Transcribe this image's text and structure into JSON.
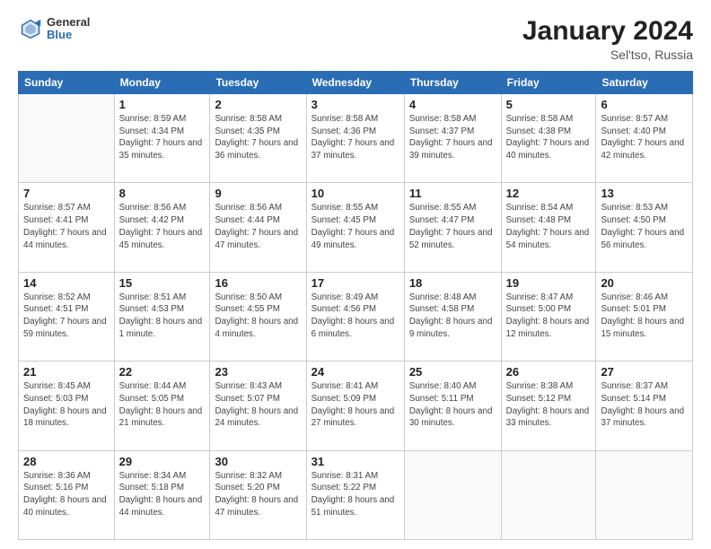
{
  "header": {
    "logo": {
      "general": "General",
      "blue": "Blue"
    },
    "title": "January 2024",
    "subtitle": "Sel'tso, Russia"
  },
  "calendar": {
    "days_of_week": [
      "Sunday",
      "Monday",
      "Tuesday",
      "Wednesday",
      "Thursday",
      "Friday",
      "Saturday"
    ],
    "weeks": [
      [
        {
          "day": "",
          "sunrise": "",
          "sunset": "",
          "daylight": "",
          "empty": true
        },
        {
          "day": "1",
          "sunrise": "Sunrise: 8:59 AM",
          "sunset": "Sunset: 4:34 PM",
          "daylight": "Daylight: 7 hours and 35 minutes."
        },
        {
          "day": "2",
          "sunrise": "Sunrise: 8:58 AM",
          "sunset": "Sunset: 4:35 PM",
          "daylight": "Daylight: 7 hours and 36 minutes."
        },
        {
          "day": "3",
          "sunrise": "Sunrise: 8:58 AM",
          "sunset": "Sunset: 4:36 PM",
          "daylight": "Daylight: 7 hours and 37 minutes."
        },
        {
          "day": "4",
          "sunrise": "Sunrise: 8:58 AM",
          "sunset": "Sunset: 4:37 PM",
          "daylight": "Daylight: 7 hours and 39 minutes."
        },
        {
          "day": "5",
          "sunrise": "Sunrise: 8:58 AM",
          "sunset": "Sunset: 4:38 PM",
          "daylight": "Daylight: 7 hours and 40 minutes."
        },
        {
          "day": "6",
          "sunrise": "Sunrise: 8:57 AM",
          "sunset": "Sunset: 4:40 PM",
          "daylight": "Daylight: 7 hours and 42 minutes."
        }
      ],
      [
        {
          "day": "7",
          "sunrise": "Sunrise: 8:57 AM",
          "sunset": "Sunset: 4:41 PM",
          "daylight": "Daylight: 7 hours and 44 minutes."
        },
        {
          "day": "8",
          "sunrise": "Sunrise: 8:56 AM",
          "sunset": "Sunset: 4:42 PM",
          "daylight": "Daylight: 7 hours and 45 minutes."
        },
        {
          "day": "9",
          "sunrise": "Sunrise: 8:56 AM",
          "sunset": "Sunset: 4:44 PM",
          "daylight": "Daylight: 7 hours and 47 minutes."
        },
        {
          "day": "10",
          "sunrise": "Sunrise: 8:55 AM",
          "sunset": "Sunset: 4:45 PM",
          "daylight": "Daylight: 7 hours and 49 minutes."
        },
        {
          "day": "11",
          "sunrise": "Sunrise: 8:55 AM",
          "sunset": "Sunset: 4:47 PM",
          "daylight": "Daylight: 7 hours and 52 minutes."
        },
        {
          "day": "12",
          "sunrise": "Sunrise: 8:54 AM",
          "sunset": "Sunset: 4:48 PM",
          "daylight": "Daylight: 7 hours and 54 minutes."
        },
        {
          "day": "13",
          "sunrise": "Sunrise: 8:53 AM",
          "sunset": "Sunset: 4:50 PM",
          "daylight": "Daylight: 7 hours and 56 minutes."
        }
      ],
      [
        {
          "day": "14",
          "sunrise": "Sunrise: 8:52 AM",
          "sunset": "Sunset: 4:51 PM",
          "daylight": "Daylight: 7 hours and 59 minutes."
        },
        {
          "day": "15",
          "sunrise": "Sunrise: 8:51 AM",
          "sunset": "Sunset: 4:53 PM",
          "daylight": "Daylight: 8 hours and 1 minute."
        },
        {
          "day": "16",
          "sunrise": "Sunrise: 8:50 AM",
          "sunset": "Sunset: 4:55 PM",
          "daylight": "Daylight: 8 hours and 4 minutes."
        },
        {
          "day": "17",
          "sunrise": "Sunrise: 8:49 AM",
          "sunset": "Sunset: 4:56 PM",
          "daylight": "Daylight: 8 hours and 6 minutes."
        },
        {
          "day": "18",
          "sunrise": "Sunrise: 8:48 AM",
          "sunset": "Sunset: 4:58 PM",
          "daylight": "Daylight: 8 hours and 9 minutes."
        },
        {
          "day": "19",
          "sunrise": "Sunrise: 8:47 AM",
          "sunset": "Sunset: 5:00 PM",
          "daylight": "Daylight: 8 hours and 12 minutes."
        },
        {
          "day": "20",
          "sunrise": "Sunrise: 8:46 AM",
          "sunset": "Sunset: 5:01 PM",
          "daylight": "Daylight: 8 hours and 15 minutes."
        }
      ],
      [
        {
          "day": "21",
          "sunrise": "Sunrise: 8:45 AM",
          "sunset": "Sunset: 5:03 PM",
          "daylight": "Daylight: 8 hours and 18 minutes."
        },
        {
          "day": "22",
          "sunrise": "Sunrise: 8:44 AM",
          "sunset": "Sunset: 5:05 PM",
          "daylight": "Daylight: 8 hours and 21 minutes."
        },
        {
          "day": "23",
          "sunrise": "Sunrise: 8:43 AM",
          "sunset": "Sunset: 5:07 PM",
          "daylight": "Daylight: 8 hours and 24 minutes."
        },
        {
          "day": "24",
          "sunrise": "Sunrise: 8:41 AM",
          "sunset": "Sunset: 5:09 PM",
          "daylight": "Daylight: 8 hours and 27 minutes."
        },
        {
          "day": "25",
          "sunrise": "Sunrise: 8:40 AM",
          "sunset": "Sunset: 5:11 PM",
          "daylight": "Daylight: 8 hours and 30 minutes."
        },
        {
          "day": "26",
          "sunrise": "Sunrise: 8:38 AM",
          "sunset": "Sunset: 5:12 PM",
          "daylight": "Daylight: 8 hours and 33 minutes."
        },
        {
          "day": "27",
          "sunrise": "Sunrise: 8:37 AM",
          "sunset": "Sunset: 5:14 PM",
          "daylight": "Daylight: 8 hours and 37 minutes."
        }
      ],
      [
        {
          "day": "28",
          "sunrise": "Sunrise: 8:36 AM",
          "sunset": "Sunset: 5:16 PM",
          "daylight": "Daylight: 8 hours and 40 minutes."
        },
        {
          "day": "29",
          "sunrise": "Sunrise: 8:34 AM",
          "sunset": "Sunset: 5:18 PM",
          "daylight": "Daylight: 8 hours and 44 minutes."
        },
        {
          "day": "30",
          "sunrise": "Sunrise: 8:32 AM",
          "sunset": "Sunset: 5:20 PM",
          "daylight": "Daylight: 8 hours and 47 minutes."
        },
        {
          "day": "31",
          "sunrise": "Sunrise: 8:31 AM",
          "sunset": "Sunset: 5:22 PM",
          "daylight": "Daylight: 8 hours and 51 minutes."
        },
        {
          "day": "",
          "sunrise": "",
          "sunset": "",
          "daylight": "",
          "empty": true
        },
        {
          "day": "",
          "sunrise": "",
          "sunset": "",
          "daylight": "",
          "empty": true
        },
        {
          "day": "",
          "sunrise": "",
          "sunset": "",
          "daylight": "",
          "empty": true
        }
      ]
    ]
  }
}
